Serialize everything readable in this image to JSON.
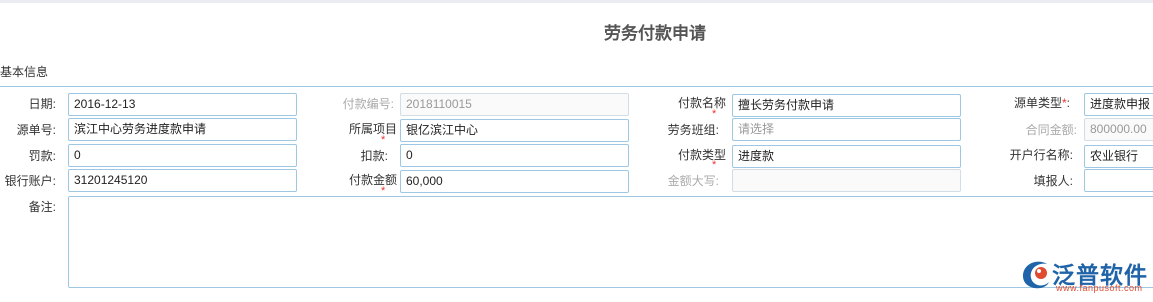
{
  "page": {
    "title": "劳务付款申请"
  },
  "section": {
    "title": "基本信息"
  },
  "labels": {
    "date": "日期:",
    "payment_no": "付款编号:",
    "payment_name": "付款名称",
    "source_type": "源单类型",
    "source_no": "源单号:",
    "project": "所属项目",
    "labor_team": "劳务班组:",
    "contract_amount": "合同金额:",
    "fine": "罚款:",
    "deduction": "扣款:",
    "payment_type": "付款类型",
    "bank_name": "开户行名称:",
    "bank_account": "银行账户:",
    "payment_amount": "付款金额",
    "amount_upper": "金额大写:",
    "filler": "填报人:",
    "remark": "备注:"
  },
  "required_mark": "*",
  "source_type_suffix": ":",
  "values": {
    "date": "2016-12-13",
    "payment_no": "2018110015",
    "payment_name": "擅长劳务付款申请",
    "source_type": "进度款申报",
    "source_no": "滨江中心劳务进度款申请",
    "project": "银亿滨江中心",
    "labor_team_placeholder": "请选择",
    "contract_amount": "800000.00",
    "fine": "0",
    "deduction": "0",
    "payment_type": "进度款",
    "bank_name": "农业银行",
    "bank_account": "31201245120",
    "payment_amount": "60,000",
    "amount_upper": "",
    "filler": ""
  },
  "logo": {
    "name": "泛普软件",
    "url": "www.fanpusoft.com",
    "colors": {
      "primary": "#1f63a8",
      "accent": "#e04a2f"
    }
  }
}
